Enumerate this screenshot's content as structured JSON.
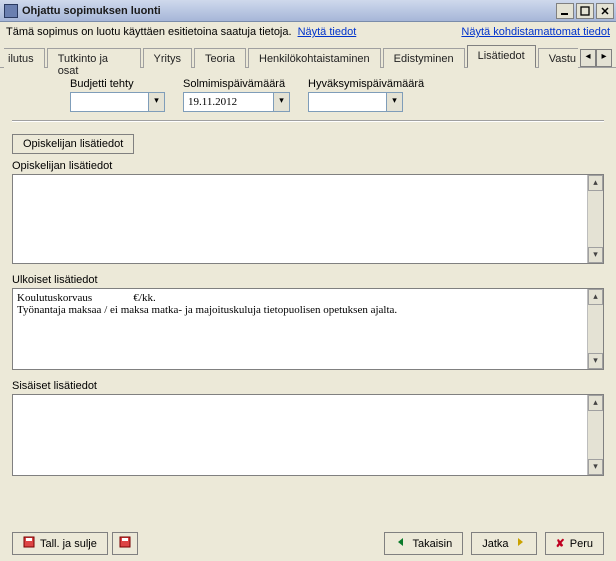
{
  "window": {
    "title": "Ohjattu sopimuksen luonti"
  },
  "infobar": {
    "text": "Tämä sopimus on luotu käyttäen esitietoina saatuja tietoja.",
    "link_left": "Näytä tiedot",
    "link_right": "Näytä kohdistamattomat tiedot"
  },
  "tabs": {
    "items": [
      "ilutus",
      "Tutkinto ja osat",
      "Yritys",
      "Teoria",
      "Henkilökohtaistaminen",
      "Edistyminen",
      "Lisätiedot",
      "Vastu"
    ],
    "active_index": 6
  },
  "fields": {
    "budjetti": {
      "label": "Budjetti tehty",
      "value": ""
    },
    "solmimis": {
      "label": "Solmimispäivämäärä",
      "value": "19.11.2012"
    },
    "hyvaksymis": {
      "label": "Hyväksymispäivämäärä",
      "value": ""
    }
  },
  "sub_tab": {
    "label": "Opiskelijan lisätiedot"
  },
  "sections": {
    "opiskelija": {
      "label": "Opiskelijan lisätiedot",
      "value": ""
    },
    "ulkoiset": {
      "label": "Ulkoiset lisätiedot",
      "value": "Koulutuskorvaus               €/kk.\nTyönantaja maksaa / ei maksa matka- ja majoituskuluja tietopuolisen opetuksen ajalta."
    },
    "sisaiset": {
      "label": "Sisäiset lisätiedot",
      "value": ""
    }
  },
  "footer": {
    "save_close": "Tall. ja sulje",
    "back": "Takaisin",
    "next": "Jatka",
    "cancel": "Peru"
  }
}
